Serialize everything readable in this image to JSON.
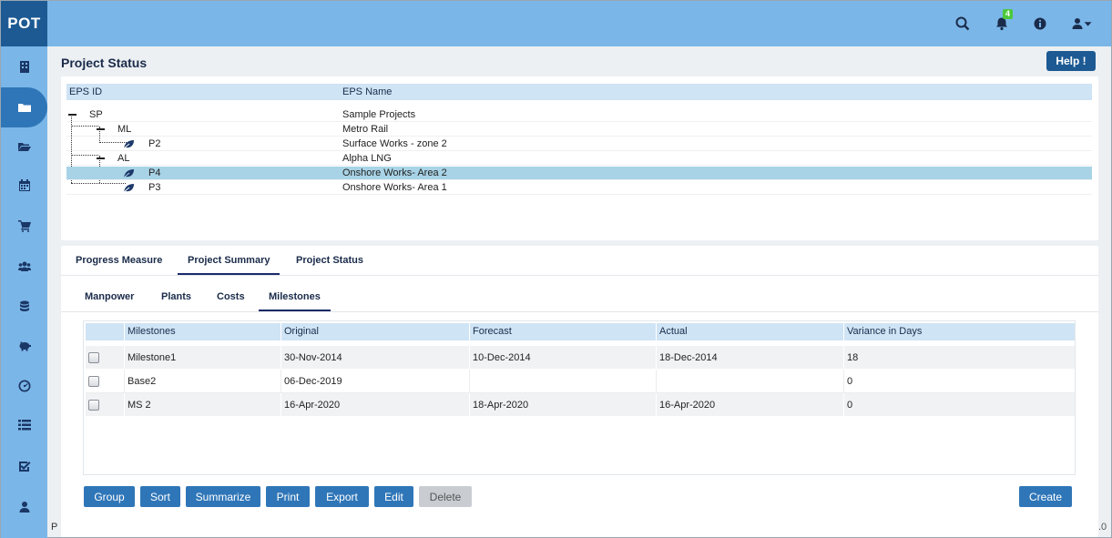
{
  "app": {
    "logo": "POT",
    "title": "Project Status"
  },
  "topbar": {
    "notification_count": "4",
    "icons": [
      "search-icon",
      "bell-icon",
      "info-icon",
      "user-icon",
      "caret-down-icon"
    ]
  },
  "sidebar": {
    "icons": [
      "building-icon",
      "folder-icon",
      "folder-open-icon",
      "calendar-icon",
      "cart-icon",
      "users-icon",
      "database-icon",
      "piggy-bank-icon",
      "dashboard-icon",
      "list-icon",
      "check-square-icon",
      "user-icon"
    ],
    "active_index": 1
  },
  "help_label": "Help !",
  "eps": {
    "headers": {
      "id": "EPS ID",
      "name": "EPS Name"
    },
    "rows": [
      {
        "id": "SP",
        "name": "Sample Projects"
      },
      {
        "id": "ML",
        "name": "Metro Rail"
      },
      {
        "id": "P2",
        "name": "Surface Works - zone 2"
      },
      {
        "id": "AL",
        "name": "Alpha LNG"
      },
      {
        "id": "P4",
        "name": "Onshore Works- Area 2",
        "selected": true
      },
      {
        "id": "P3",
        "name": "Onshore Works- Area 1"
      }
    ]
  },
  "tabs": [
    "Progress Measure",
    "Project Summary",
    "Project Status"
  ],
  "active_tab": "Project Summary",
  "subtabs": [
    "Manpower",
    "Plants",
    "Costs",
    "Milestones"
  ],
  "active_subtab": "Milestones",
  "milestones": {
    "headers": {
      "name": "Milestones",
      "original": "Original",
      "forecast": "Forecast",
      "actual": "Actual",
      "variance": "Variance in Days"
    },
    "rows": [
      {
        "name": "Milestone1",
        "original": "30-Nov-2014",
        "forecast": "10-Dec-2014",
        "actual": "18-Dec-2014",
        "variance": "18"
      },
      {
        "name": "Base2",
        "original": "06-Dec-2019",
        "forecast": "",
        "actual": "",
        "variance": "0"
      },
      {
        "name": "MS 2",
        "original": "16-Apr-2020",
        "forecast": "18-Apr-2020",
        "actual": "16-Apr-2020",
        "variance": "0"
      }
    ]
  },
  "buttons": {
    "group": "Group",
    "sort": "Sort",
    "summarize": "Summarize",
    "print": "Print",
    "export": "Export",
    "edit": "Edit",
    "delete": "Delete",
    "create": "Create"
  },
  "footer": {
    "left": "Pr",
    "right": ".0"
  },
  "colors": {
    "topbar": "#7bb6e8",
    "logo_bg": "#1d5a93",
    "button": "#2f76b8",
    "header_row": "#cfe4f5",
    "selected_row": "#a8d3e6",
    "badge": "#4bc93a"
  }
}
